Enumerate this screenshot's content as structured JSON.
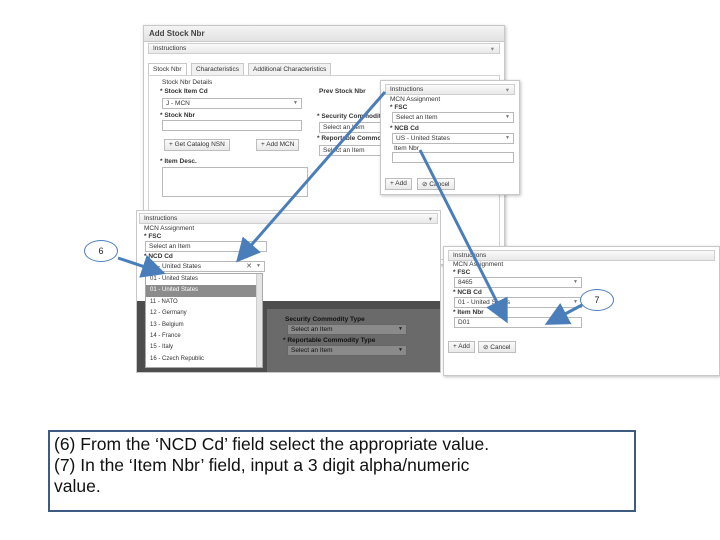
{
  "main_dialog": {
    "title": "Add Stock Nbr",
    "instructions_bar": "Instructions",
    "tabs": [
      "Stock Nbr",
      "Characteristics",
      "Additional Characteristics"
    ],
    "section_title": "Stock Nbr Details",
    "stock_item_cd_label": "* Stock Item Cd",
    "stock_item_cd_value": "J - MCN",
    "stock_nbr_label": "* Stock Nbr",
    "prev_stock_nbr_label": "Prev Stock Nbr",
    "security_commodity_label": "* Security Commodity",
    "security_commodity_value": "Select an Item",
    "reportable_commodity_label": "* Reportable Commod",
    "reportable_commodity_value": "Select an Item",
    "get_catalog_button": "Get Catalog NSN",
    "add_mcn_button": "Add MCN",
    "item_desc_label": "* Item Desc."
  },
  "mcn_panel_top": {
    "instructions_bar": "Instructions",
    "section_title": "MCN Assignment",
    "fsc_label": "* FSC",
    "fsc_value": "Select an Item",
    "ncb_label": "* NCB Cd",
    "ncb_value": "US - United States",
    "item_nbr_label": "Item Nbr",
    "add_button": "Add",
    "cancel_button": "Cancel"
  },
  "mcn_panel_left": {
    "instructions_bar": "Instructions",
    "section_title": "MCN Assignment",
    "fsc_label": "* FSC",
    "fsc_value": "Select an Item",
    "ncd_label": "* NCD Cd",
    "ncd_value": "01 - United States",
    "dropdown_options": [
      "01 - United States",
      "01 - United States",
      "11 - NATO",
      "12 - Germany",
      "13 - Belgium",
      "14 - France",
      "15 - Italy",
      "16 - Czech Republic"
    ]
  },
  "mcn_panel_right": {
    "instructions_bar": "Instructions",
    "section_title": "MCN Assignment",
    "fsc_label": "* FSC",
    "fsc_value": "8465",
    "ncb_label": "* NCB Cd",
    "ncb_value": "01 - United States",
    "item_nbr_label": "* Item Nbr",
    "item_nbr_value": "D01",
    "add_button": "Add",
    "cancel_button": "Cancel"
  },
  "background_fragment": {
    "security_commodity_type_label": "Security Commodity Type",
    "security_value": "Select an Item",
    "reportable_commodity_type_label": "* Reportable Commodity Type",
    "reportable_value": "Select an Item"
  },
  "callouts": {
    "step6": "6",
    "step7": "7"
  },
  "instructions_text": {
    "line1": "(6)  From the ‘NCD Cd’ field select the appropriate value.",
    "line2": "(7) In the ‘Item Nbr’ field, input a 3 digit alpha/numeric",
    "line3": "value."
  },
  "colors": {
    "arrow": "#4a7ebb",
    "callout_border": "#4a7ebb",
    "instruction_border": "#3d5a80",
    "highlight": "#8c8c8c"
  }
}
